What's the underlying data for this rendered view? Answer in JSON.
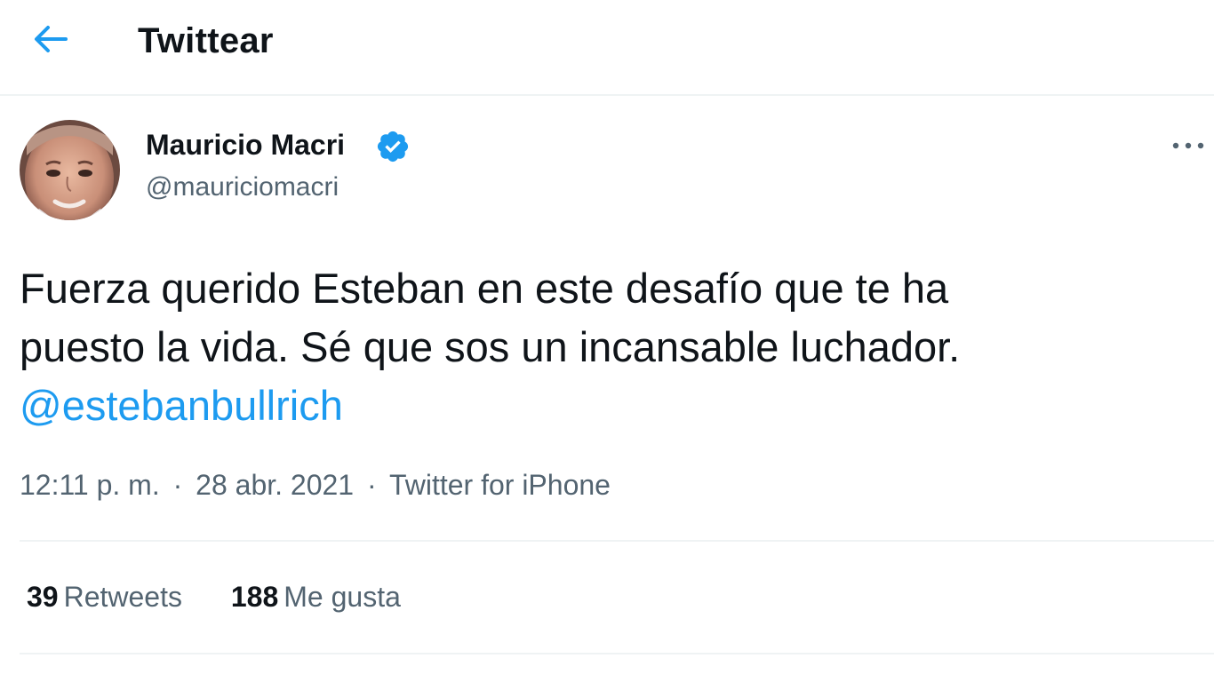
{
  "header": {
    "back_icon": "arrow-left-icon",
    "title": "Twittear"
  },
  "author": {
    "name": "Mauricio Macri",
    "verified_icon": "verified-badge-icon",
    "handle": "@mauriciomacri"
  },
  "tweet": {
    "line1": "Fuerza querido Esteban en este desafío que te ha",
    "line2": "puesto la vida. Sé que sos un incansable luchador.",
    "mention": "@estebanbullrich"
  },
  "meta": {
    "time": "12:11 p. m.",
    "separator": "·",
    "date": "28 abr. 2021",
    "source": "Twitter for iPhone"
  },
  "stats": {
    "retweets": {
      "count": "39",
      "label": "Retweets"
    },
    "likes": {
      "count": "188",
      "label": "Me gusta"
    }
  },
  "more_icon": "more-horizontal-icon",
  "colors": {
    "accent": "#1d9bf0",
    "text": "#0f1419",
    "secondary": "#536471",
    "border": "#eff3f4"
  }
}
